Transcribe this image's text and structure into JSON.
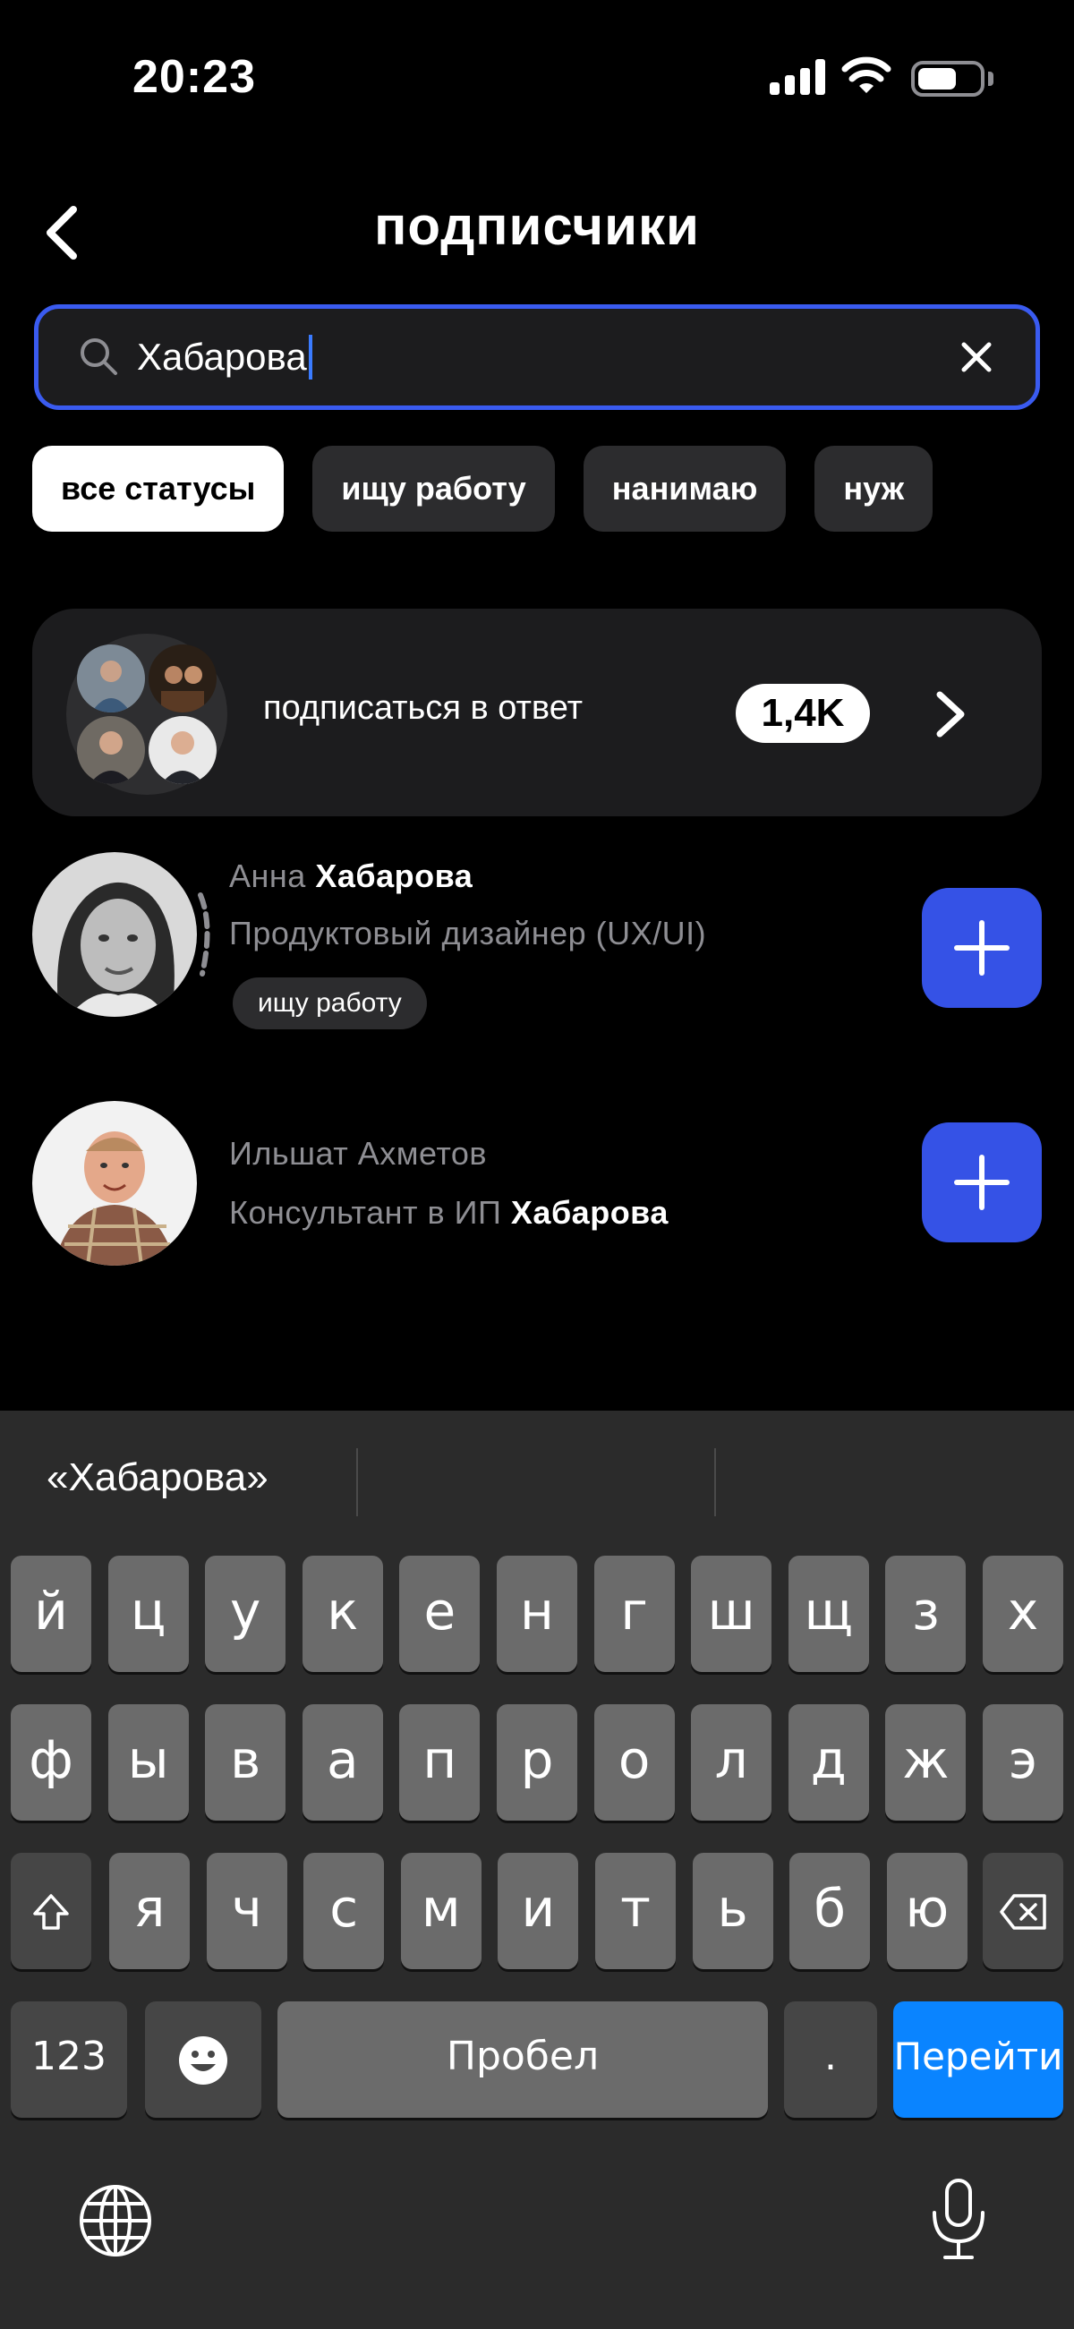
{
  "status_bar": {
    "time": "20:23"
  },
  "header": {
    "title": "подписчики"
  },
  "search": {
    "value": "Хабарова"
  },
  "filters": [
    {
      "label": "все статусы",
      "active": true
    },
    {
      "label": "ищу работу",
      "active": false
    },
    {
      "label": "нанимаю",
      "active": false
    },
    {
      "label": "нуж",
      "active": false
    }
  ],
  "follow_back": {
    "label": "подписаться в ответ",
    "count": "1,4K"
  },
  "users": [
    {
      "first_name": "Анна",
      "last_name": "Хабарова",
      "subtitle_plain": "Продуктовый дизайнер (UX/UI)",
      "status": "ищу работу"
    },
    {
      "name": "Ильшат Ахметов",
      "subtitle_plain": "Консультант в ИП",
      "subtitle_highlight": "Хабарова"
    }
  ],
  "keyboard": {
    "suggestion": "«Хабарова»",
    "row1": [
      "й",
      "ц",
      "у",
      "к",
      "е",
      "н",
      "г",
      "ш",
      "щ",
      "з",
      "х"
    ],
    "row2": [
      "ф",
      "ы",
      "в",
      "а",
      "п",
      "р",
      "о",
      "л",
      "д",
      "ж",
      "э"
    ],
    "row3": [
      "я",
      "ч",
      "с",
      "м",
      "и",
      "т",
      "ь",
      "б",
      "ю"
    ],
    "numbers_label": "123",
    "space_label": "Пробел",
    "period_label": ".",
    "go_label": "Перейти"
  },
  "colors": {
    "accent_blue": "#3552e6",
    "search_border": "#3a5bf0",
    "key_go": "#0a84ff"
  }
}
